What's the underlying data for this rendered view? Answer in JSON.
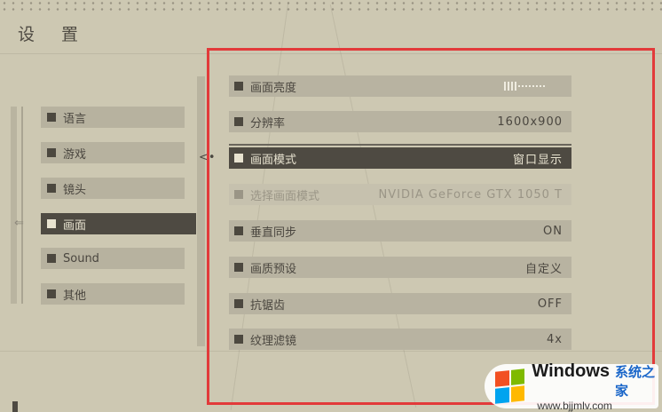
{
  "page": {
    "title": "设 置"
  },
  "menu": {
    "items": [
      {
        "label": "语言",
        "active": false
      },
      {
        "label": "游戏",
        "active": false
      },
      {
        "label": "镜头",
        "active": false
      },
      {
        "label": "画面",
        "active": true
      },
      {
        "label": "Sound",
        "active": false
      },
      {
        "label": "其他",
        "active": false
      }
    ]
  },
  "settings": [
    {
      "label": "画面亮度",
      "value": "",
      "type": "brightness",
      "brightness_level": 0.25
    },
    {
      "label": "分辨率",
      "value": "1600x900"
    },
    {
      "label": "画面模式",
      "value": "窗口显示",
      "active": true
    },
    {
      "label": "选择画面模式",
      "value": "NVIDIA GeForce GTX 1050 T",
      "disabled": true
    },
    {
      "label": "垂直同步",
      "value": "ON"
    },
    {
      "label": "画质预设",
      "value": "自定义"
    },
    {
      "label": "抗锯齿",
      "value": "OFF"
    },
    {
      "label": "纹理滤镜",
      "value": "4x"
    }
  ],
  "cursor_glyph": "⇐",
  "highlight_color": "#e23a3a",
  "watermark": {
    "brand": "Windows",
    "cn": "系统之家",
    "url": "www.bjjmlv.com"
  }
}
